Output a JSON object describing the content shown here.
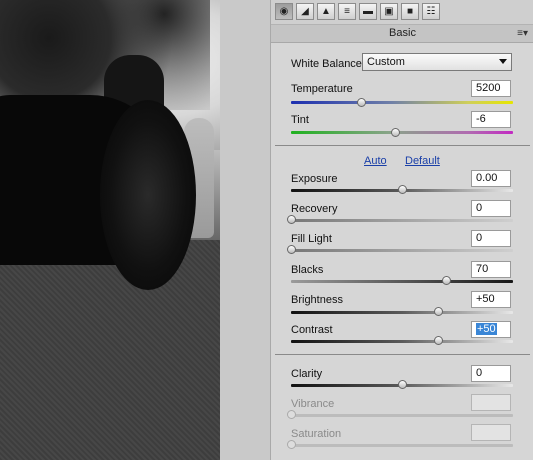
{
  "toolbar": {
    "icons": [
      "aperture-icon",
      "tone-curve-icon",
      "detail-icon",
      "hsl-icon",
      "split-toning-icon",
      "lens-icon",
      "camera-icon",
      "presets-icon"
    ]
  },
  "panel": {
    "title": "Basic",
    "menu_icon": "≡▾"
  },
  "white_balance": {
    "label": "White Balance:",
    "value": "Custom"
  },
  "links": {
    "auto": "Auto",
    "default": "Default"
  },
  "sliders": [
    {
      "label": "Temperature",
      "value": "5200",
      "position": 0.33
    },
    {
      "label": "Tint",
      "value": "-6",
      "position": 0.47
    },
    {
      "label": "Exposure",
      "value": "0.00",
      "position": 0.5
    },
    {
      "label": "Recovery",
      "value": "0",
      "position": 0.0
    },
    {
      "label": "Fill Light",
      "value": "0",
      "position": 0.0
    },
    {
      "label": "Blacks",
      "value": "70",
      "position": 0.7
    },
    {
      "label": "Brightness",
      "value": "+50",
      "position": 0.67
    },
    {
      "label": "Contrast",
      "value": "+50",
      "position": 0.67
    },
    {
      "label": "Clarity",
      "value": "0",
      "position": 0.5
    },
    {
      "label": "Vibrance",
      "value": "",
      "position": 0.0
    },
    {
      "label": "Saturation",
      "value": "",
      "position": 0.0
    }
  ]
}
